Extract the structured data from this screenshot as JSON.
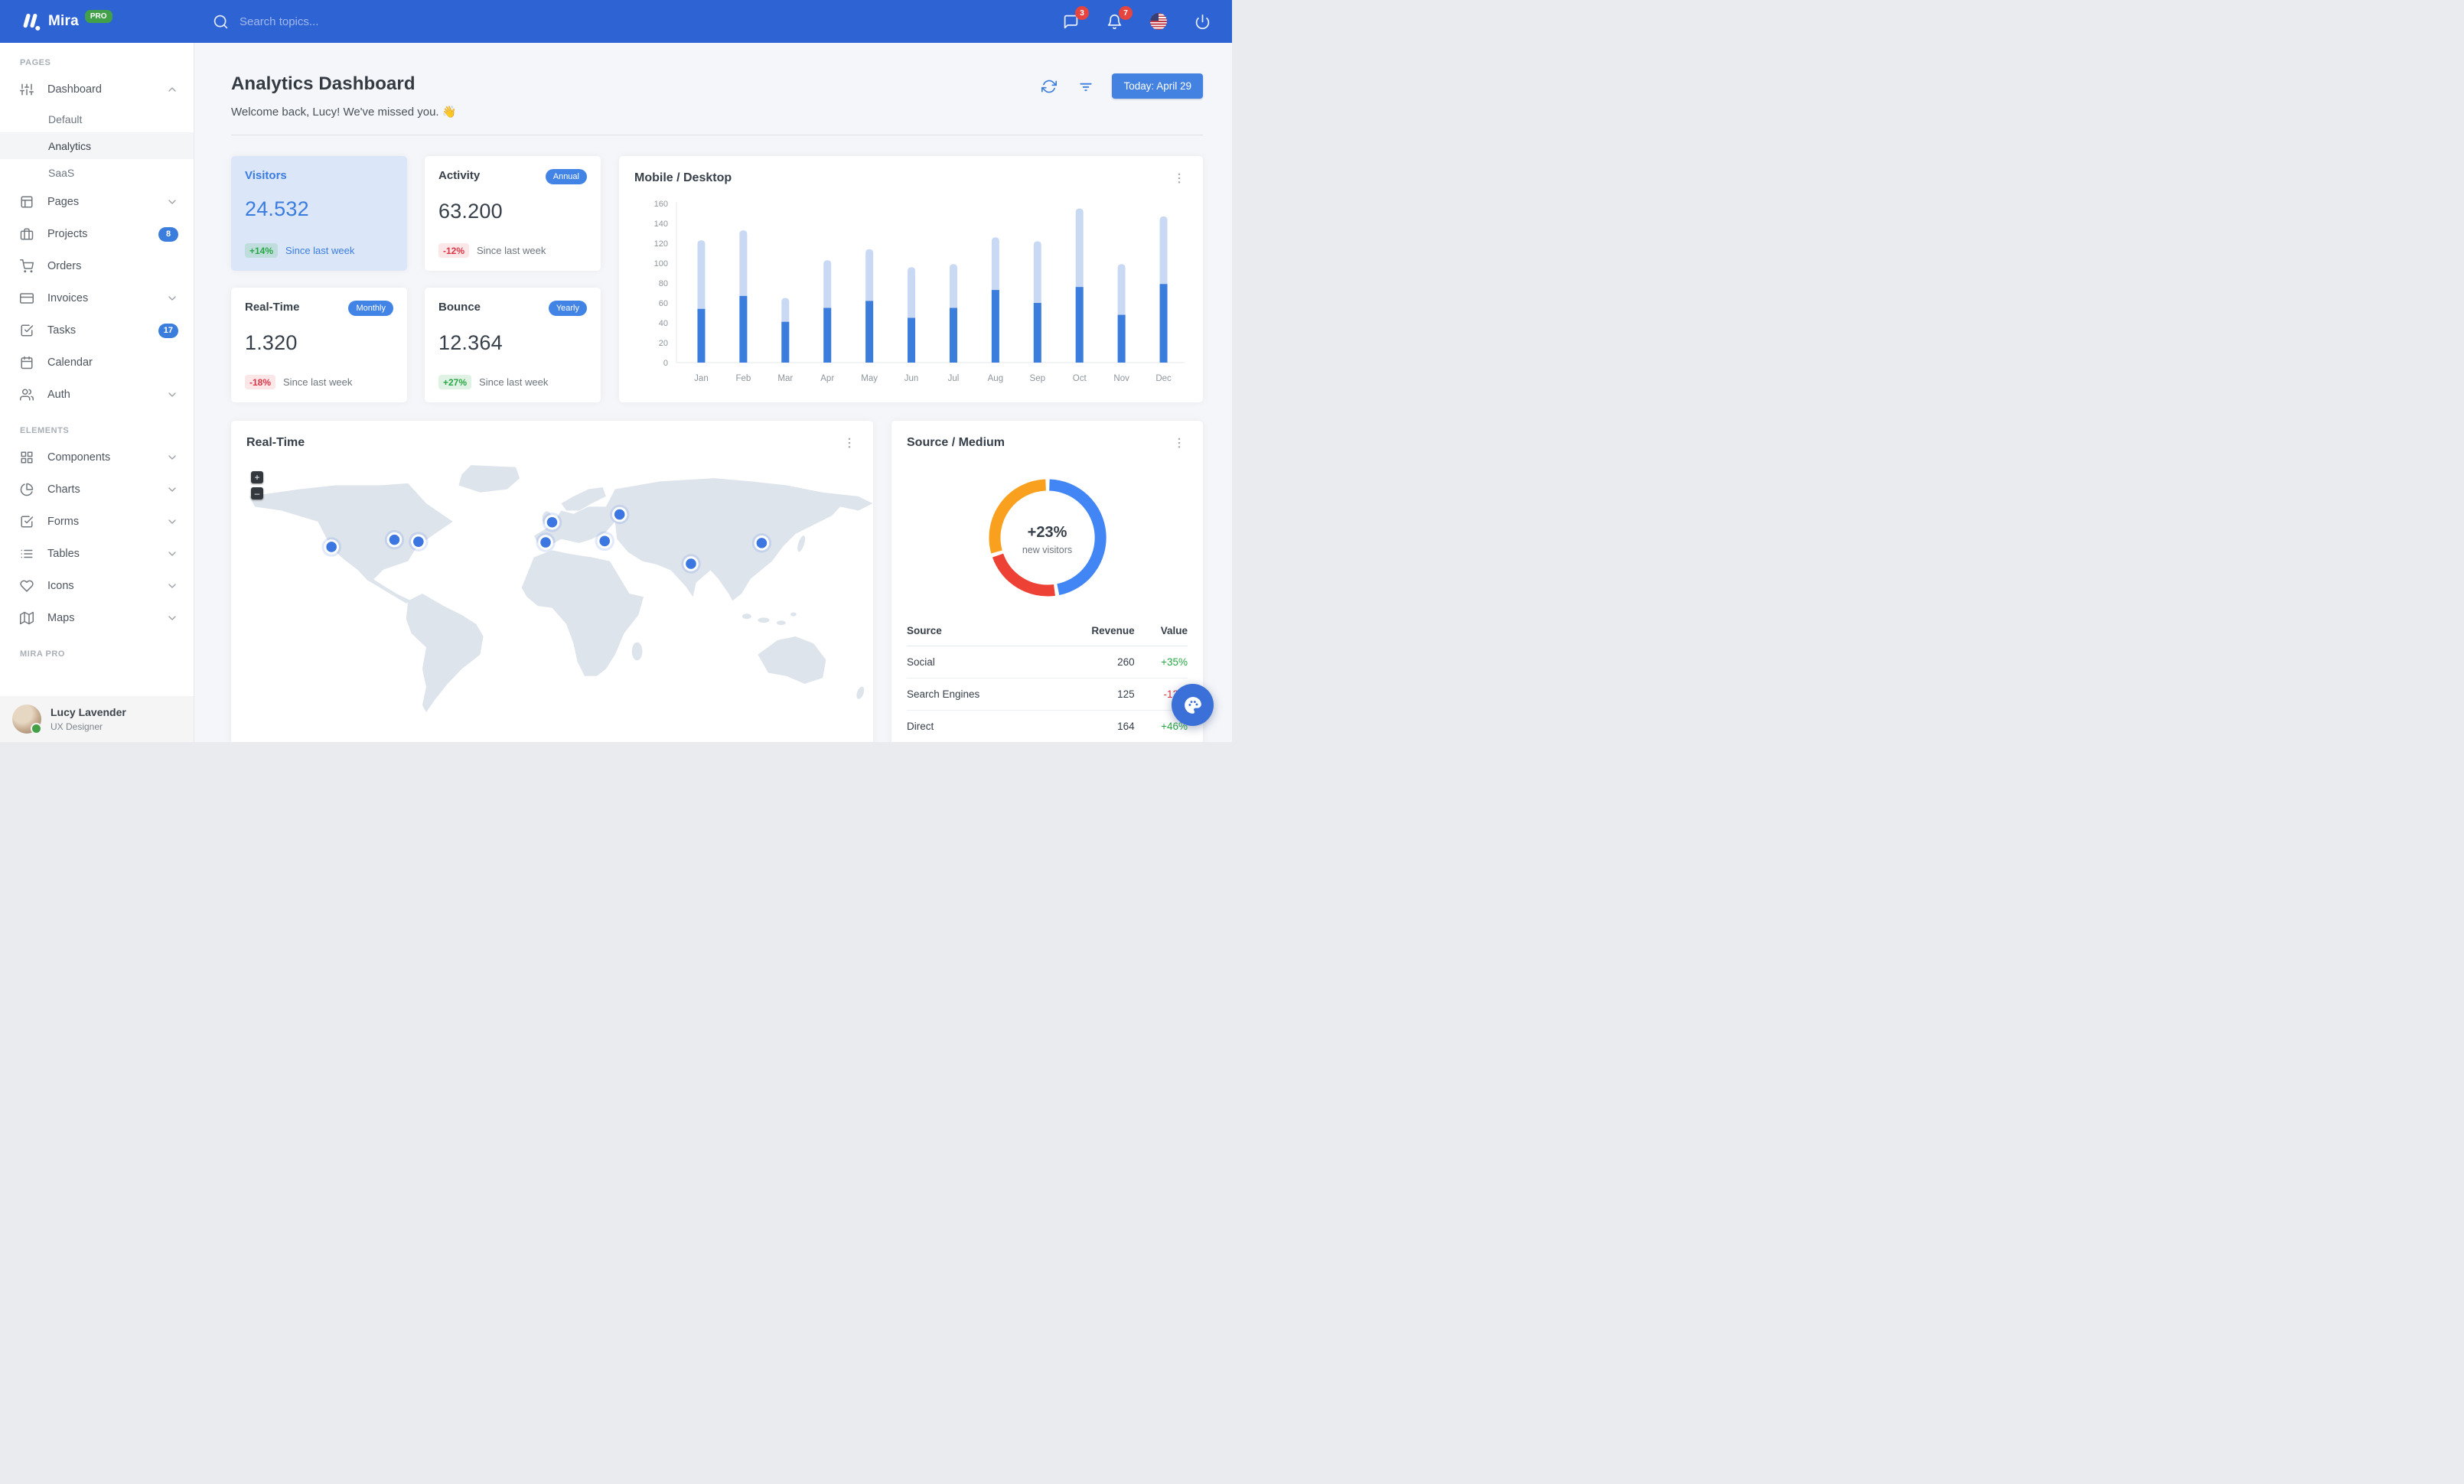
{
  "navbar": {
    "brand": "Mira",
    "brand_badge": "PRO",
    "search_placeholder": "Search topics...",
    "messages_badge": "3",
    "notifications_badge": "7"
  },
  "sidebar": {
    "sections": [
      {
        "label": "PAGES",
        "items": [
          {
            "icon": "sliders",
            "label": "Dashboard",
            "chevron": "up",
            "children": [
              {
                "label": "Default",
                "active": false
              },
              {
                "label": "Analytics",
                "active": true
              },
              {
                "label": "SaaS",
                "active": false
              }
            ]
          },
          {
            "icon": "layout",
            "label": "Pages",
            "chevron": "down"
          },
          {
            "icon": "briefcase",
            "label": "Projects",
            "badge": "8"
          },
          {
            "icon": "shopping-cart",
            "label": "Orders"
          },
          {
            "icon": "credit-card",
            "label": "Invoices",
            "chevron": "down"
          },
          {
            "icon": "check-square",
            "label": "Tasks",
            "badge": "17"
          },
          {
            "icon": "calendar",
            "label": "Calendar"
          },
          {
            "icon": "users",
            "label": "Auth",
            "chevron": "down"
          }
        ]
      },
      {
        "label": "ELEMENTS",
        "items": [
          {
            "icon": "grid",
            "label": "Components",
            "chevron": "down"
          },
          {
            "icon": "pie-chart",
            "label": "Charts",
            "chevron": "down"
          },
          {
            "icon": "check-square",
            "label": "Forms",
            "chevron": "down"
          },
          {
            "icon": "list",
            "label": "Tables",
            "chevron": "down"
          },
          {
            "icon": "heart",
            "label": "Icons",
            "chevron": "down"
          },
          {
            "icon": "map",
            "label": "Maps",
            "chevron": "down"
          }
        ]
      },
      {
        "label": "MIRA PRO",
        "items": []
      }
    ],
    "user": {
      "name": "Lucy Lavender",
      "role": "UX Designer",
      "status": "online"
    }
  },
  "header": {
    "title": "Analytics Dashboard",
    "subtitle": "Welcome back, Lucy! We've missed you. 👋",
    "date_button": "Today: April 29"
  },
  "stats": [
    {
      "title": "Visitors",
      "value": "24.532",
      "change": "+14%",
      "change_dir": "up",
      "caption": "Since last week",
      "highlight": true
    },
    {
      "title": "Activity",
      "badge": "Annual",
      "value": "63.200",
      "change": "-12%",
      "change_dir": "down",
      "caption": "Since last week",
      "highlight": false
    },
    {
      "title": "Real-Time",
      "badge": "Monthly",
      "value": "1.320",
      "change": "-18%",
      "change_dir": "down",
      "caption": "Since last week",
      "highlight": false
    },
    {
      "title": "Bounce",
      "badge": "Yearly",
      "value": "12.364",
      "change": "+27%",
      "change_dir": "up",
      "caption": "Since last week",
      "highlight": false
    }
  ],
  "chart_data": [
    {
      "type": "bar",
      "title": "Mobile / Desktop",
      "stacked": true,
      "categories": [
        "Jan",
        "Feb",
        "Mar",
        "Apr",
        "May",
        "Jun",
        "Jul",
        "Aug",
        "Sep",
        "Oct",
        "Nov",
        "Dec"
      ],
      "series": [
        {
          "name": "Mobile",
          "color": "#3b7ddd",
          "values": [
            54,
            67,
            41,
            55,
            62,
            45,
            55,
            73,
            60,
            76,
            48,
            79
          ]
        },
        {
          "name": "Desktop",
          "color": "#c9d9f4",
          "values": [
            69,
            66,
            24,
            48,
            52,
            51,
            44,
            53,
            62,
            79,
            51,
            68
          ]
        }
      ],
      "xlabel": "",
      "ylabel": "",
      "ylim": [
        0,
        160
      ],
      "ytick_step": 20,
      "grid": false,
      "legend": "none"
    },
    {
      "type": "pie",
      "subtype": "donut",
      "title": "Source / Medium",
      "center_label": "+23%",
      "center_sublabel": "new visitors",
      "slices": [
        {
          "label": "Social",
          "value": 260,
          "color": "#4285f4"
        },
        {
          "label": "Search Engines",
          "value": 125,
          "color": "#ee4136"
        },
        {
          "label": "Direct",
          "value": 164,
          "color": "#f9a11f"
        }
      ],
      "legend": "none"
    }
  ],
  "map_card": {
    "title": "Real-Time",
    "zoom_in_label": "+",
    "zoom_out_label": "–",
    "markers": [
      {
        "x": 160,
        "y": 145
      },
      {
        "x": 257,
        "y": 134
      },
      {
        "x": 294,
        "y": 137
      },
      {
        "x": 500,
        "y": 107
      },
      {
        "x": 490,
        "y": 138
      },
      {
        "x": 581,
        "y": 136
      },
      {
        "x": 604,
        "y": 95
      },
      {
        "x": 714,
        "y": 171
      },
      {
        "x": 823,
        "y": 139
      }
    ]
  },
  "source_card": {
    "title": "Source / Medium",
    "table": {
      "headers": [
        "Source",
        "Revenue",
        "Value"
      ],
      "rows": [
        {
          "source": "Social",
          "revenue": "260",
          "value": "+35%",
          "dir": "up"
        },
        {
          "source": "Search Engines",
          "revenue": "125",
          "value": "-12%",
          "dir": "down"
        },
        {
          "source": "Direct",
          "revenue": "164",
          "value": "+46%",
          "dir": "up"
        }
      ]
    }
  },
  "colors": {
    "navbar": "#2e63d4",
    "primary": "#3b7ddd",
    "success": "#28a745",
    "danger": "#dc3545",
    "highlight_card_bg": "#dbe7f9",
    "bar_dark": "#3b7ddd",
    "bar_light": "#c9d9f4",
    "donut": [
      "#4285f4",
      "#ee4136",
      "#f9a11f"
    ],
    "map_land": "#dee4eb"
  }
}
